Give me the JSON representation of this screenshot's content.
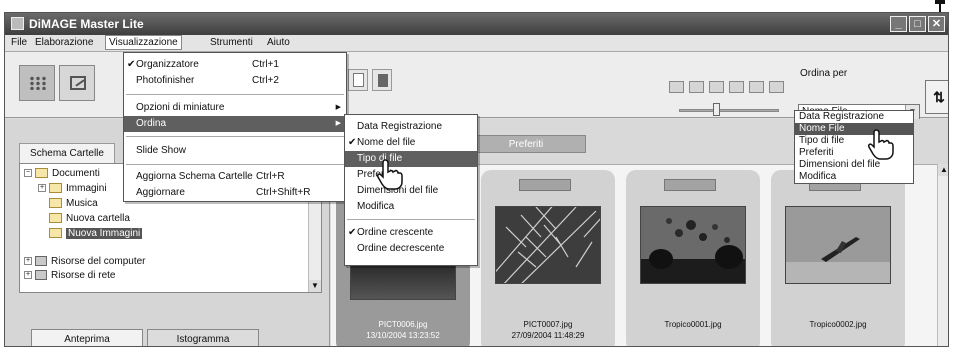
{
  "window": {
    "title": "DiMAGE Master Lite",
    "controls": [
      "_",
      "□",
      "✕"
    ]
  },
  "menubar": [
    "File",
    "Elaborazione",
    "Visualizzazione",
    "Strumenti",
    "Aiuto"
  ],
  "visualizzazione_menu": {
    "items": [
      {
        "label": "Organizzatore",
        "shortcut": "Ctrl+1",
        "checked": true
      },
      {
        "label": "Photofinisher",
        "shortcut": "Ctrl+2"
      },
      {
        "label": "Opzioni di miniature",
        "submenu": true
      },
      {
        "label": "Ordina",
        "submenu": true,
        "highlighted": true
      },
      {
        "label": "Slide Show"
      },
      {
        "label": "Aggiorna Schema Cartelle",
        "shortcut": "Ctrl+R"
      },
      {
        "label": "Aggiornare",
        "shortcut": "Ctrl+Shift+R"
      }
    ]
  },
  "ordina_submenu": {
    "items": [
      {
        "label": "Data Registrazione"
      },
      {
        "label": "Nome del file",
        "checked": true
      },
      {
        "label": "Tipo di file",
        "highlighted": true
      },
      {
        "label": "Preferiti"
      },
      {
        "label": "Dimensioni del file"
      },
      {
        "label": "Modifica"
      },
      {
        "label": "Ordine crescente",
        "checked": true
      },
      {
        "label": "Ordine decrescente"
      }
    ]
  },
  "sort": {
    "label": "Ordina per",
    "selected": "Nome File",
    "options": [
      "Data Registrazione",
      "Nome File",
      "Tipo di file",
      "Preferiti",
      "Dimensioni del file",
      "Modifica"
    ],
    "highlighted_option": "Nome File"
  },
  "left_panel": {
    "folder_tab": "Schema Cartelle",
    "tree": [
      {
        "label": "Documenti",
        "exp": "−"
      },
      {
        "label": "Immagini",
        "exp": "+"
      },
      {
        "label": "Musica"
      },
      {
        "label": "Nuova cartella"
      },
      {
        "label": "Nuova Immagini",
        "selected": true
      },
      {
        "label": "Risorse del computer",
        "exp": "+"
      },
      {
        "label": "Risorse di rete",
        "exp": "+"
      }
    ],
    "bottom_tabs": [
      "Anteprima",
      "Istogramma"
    ]
  },
  "filter_tab": "Preferiti",
  "thumbnails": [
    {
      "file": "PICT0006.jpg",
      "date": "13/10/2004 13:23:52",
      "selected": true
    },
    {
      "file": "PICT0007.jpg",
      "date": "27/09/2004 11:48:29"
    },
    {
      "file": "Tropico0001.jpg",
      "date": ""
    },
    {
      "file": "Tropico0002.jpg",
      "date": ""
    }
  ],
  "colors": {
    "titlebar": "#4a4a4a",
    "highlight": "#5f5f5f",
    "selected_card": "#9a9a9a"
  }
}
